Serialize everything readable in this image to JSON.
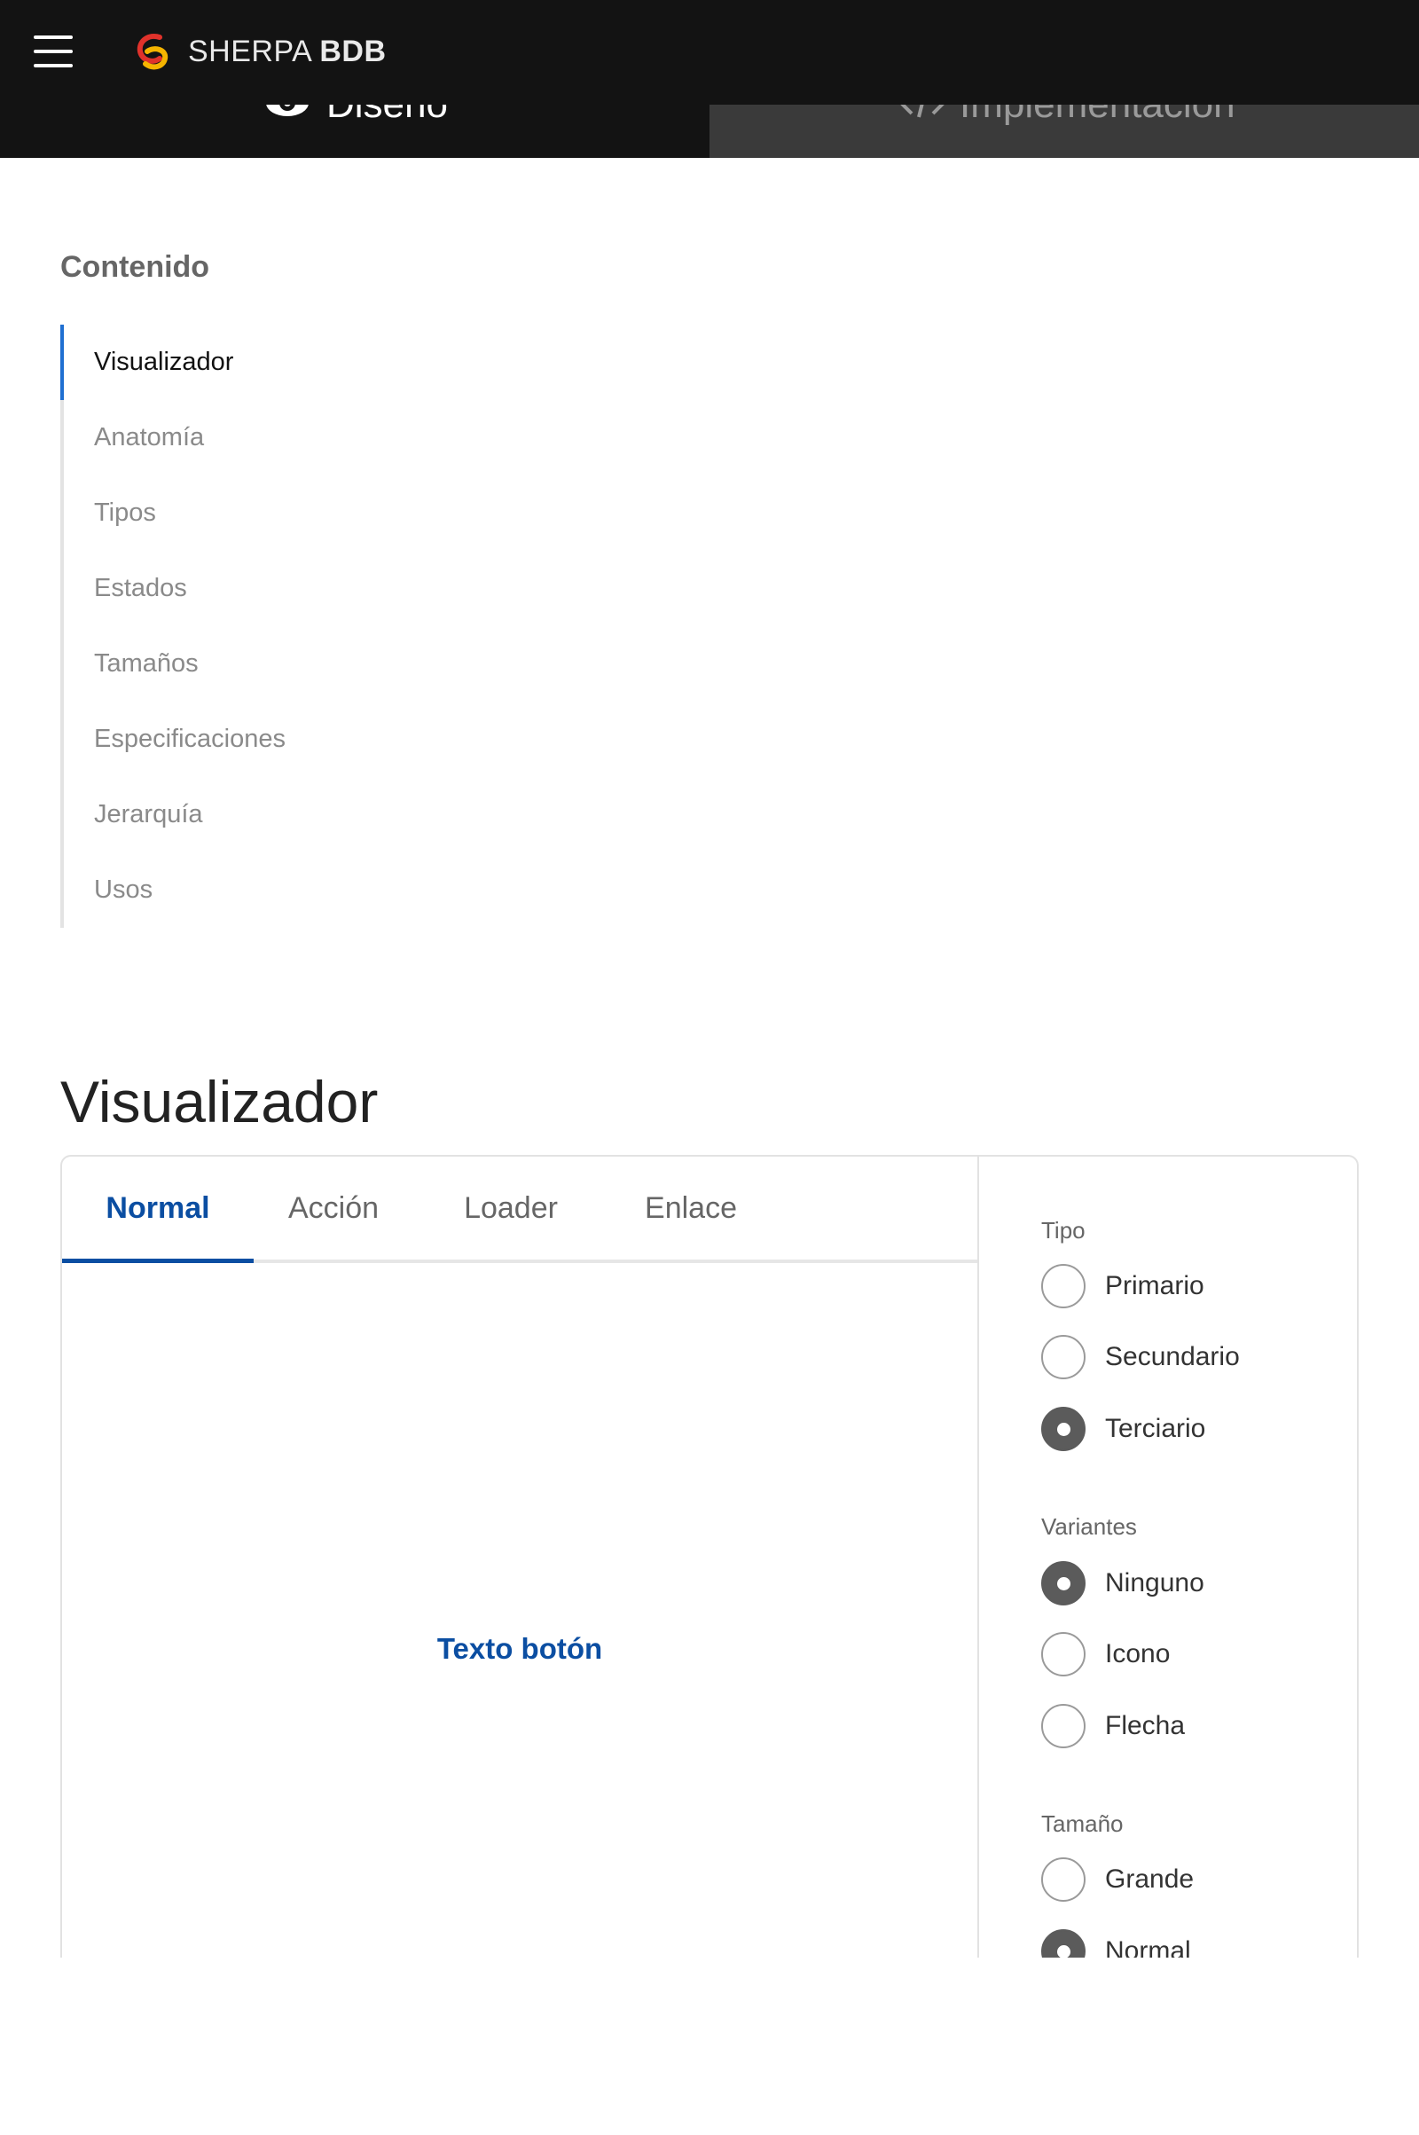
{
  "header": {
    "brand_light": "SHERPA",
    "brand_bold": "BDB"
  },
  "page_tabs": [
    {
      "label": "Diseño",
      "icon": "eye-icon",
      "active": true
    },
    {
      "label": "Implementación",
      "icon": "code-icon",
      "active": false
    }
  ],
  "toc": {
    "title": "Contenido",
    "items": [
      {
        "label": "Visualizador",
        "active": true
      },
      {
        "label": "Anatomía"
      },
      {
        "label": "Tipos"
      },
      {
        "label": "Estados"
      },
      {
        "label": "Tamaños"
      },
      {
        "label": "Especificaciones"
      },
      {
        "label": "Jerarquía"
      },
      {
        "label": "Usos"
      }
    ]
  },
  "section": {
    "title": "Visualizador"
  },
  "viewer": {
    "tabs": [
      {
        "label": "Normal",
        "active": true
      },
      {
        "label": "Acción"
      },
      {
        "label": "Loader"
      },
      {
        "label": "Enlace"
      }
    ],
    "preview_button_label": "Texto botón",
    "groups": [
      {
        "label": "Tipo",
        "options": [
          {
            "label": "Primario",
            "checked": false
          },
          {
            "label": "Secundario",
            "checked": false
          },
          {
            "label": "Terciario",
            "checked": true
          }
        ]
      },
      {
        "label": "Variantes",
        "options": [
          {
            "label": "Ninguno",
            "checked": true
          },
          {
            "label": "Icono",
            "checked": false
          },
          {
            "label": "Flecha",
            "checked": false
          }
        ]
      },
      {
        "label": "Tamaño",
        "options": [
          {
            "label": "Grande",
            "checked": false
          },
          {
            "label": "Normal",
            "checked": true
          }
        ]
      }
    ]
  },
  "colors": {
    "accent": "#0b4ea2",
    "toc_active_bar": "#1f6fd1",
    "header_bg": "#131313"
  }
}
